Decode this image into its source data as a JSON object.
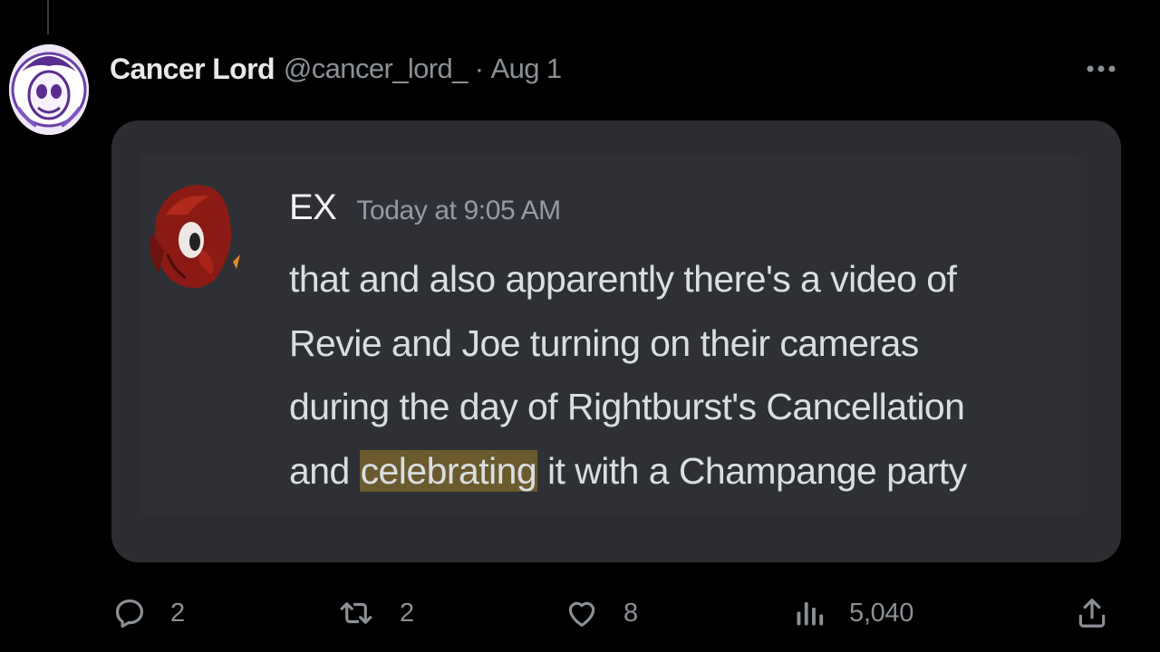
{
  "tweet": {
    "display_name": "Cancer Lord",
    "handle": "@cancer_lord_",
    "separator": "·",
    "date": "Aug 1",
    "more_icon": "more-horizontal-icon"
  },
  "embedded_message": {
    "author": "EX",
    "timestamp": "Today at 9:05 AM",
    "lines": [
      {
        "text": "that and also apparently there's a video of"
      },
      {
        "text": "Revie and Joe turning on their cameras"
      },
      {
        "text": "during the day of Rightburst's Cancellation"
      },
      {
        "before": "and ",
        "highlight": "celebrating",
        "after": " it with a Champange party"
      }
    ],
    "highlight_color": "#6a5a2e"
  },
  "actions": {
    "replies": {
      "icon": "reply-icon",
      "count": "2"
    },
    "reposts": {
      "icon": "repost-icon",
      "count": "2"
    },
    "likes": {
      "icon": "heart-icon",
      "count": "8"
    },
    "views": {
      "icon": "analytics-icon",
      "count": "5,040"
    },
    "share": {
      "icon": "share-icon"
    }
  },
  "colors": {
    "background": "#000000",
    "card": "#2b2d31",
    "muted": "#8b9096"
  }
}
